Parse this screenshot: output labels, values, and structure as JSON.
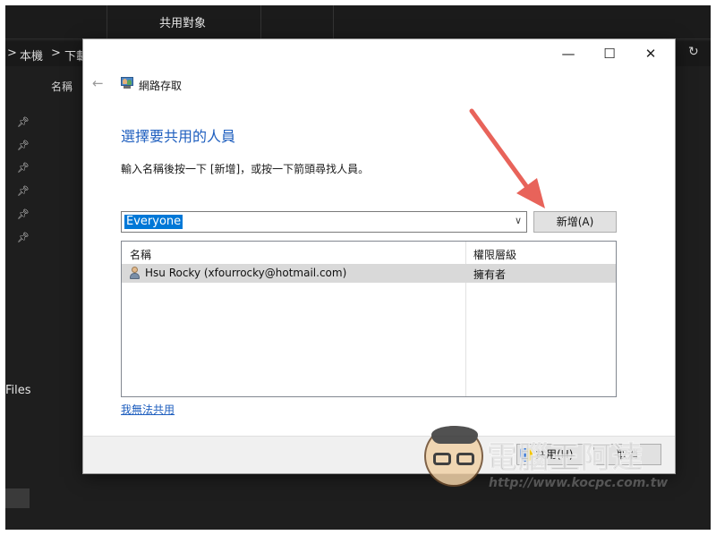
{
  "explorer": {
    "share_with_tab": "共用對象",
    "breadcrumb": [
      ">",
      "本機",
      ">",
      "下載"
    ],
    "column_name": "名稱",
    "files_label": "Files"
  },
  "dialog": {
    "title": "網路存取",
    "heading": "選擇要共用的人員",
    "instructions": "輸入名稱後按一下 [新增]，或按一下箭頭尋找人員。",
    "input_value": "Everyone",
    "add_label": "新增(A)",
    "list": {
      "columns": [
        "名稱",
        "權限層級"
      ],
      "rows": [
        {
          "name": "Hsu Rocky (xfourrocky@hotmail.com)",
          "permission": "擁有者"
        }
      ]
    },
    "help_link": "我無法共用",
    "share_label": "共用(H)",
    "cancel_label": "取消",
    "window_controls": [
      "—",
      "☐",
      "✕"
    ]
  },
  "watermark": {
    "title": "電腦王阿達",
    "url": "http://www.kocpc.com.tw"
  },
  "colors": {
    "accent": "#1f5fbf",
    "selection": "#0078d7",
    "arrow": "#e8635a"
  },
  "icons": [
    "back-arrow-icon",
    "network-access-icon",
    "chevron-down-icon",
    "user-icon",
    "uac-shield-icon",
    "pin-icon",
    "refresh-icon"
  ]
}
